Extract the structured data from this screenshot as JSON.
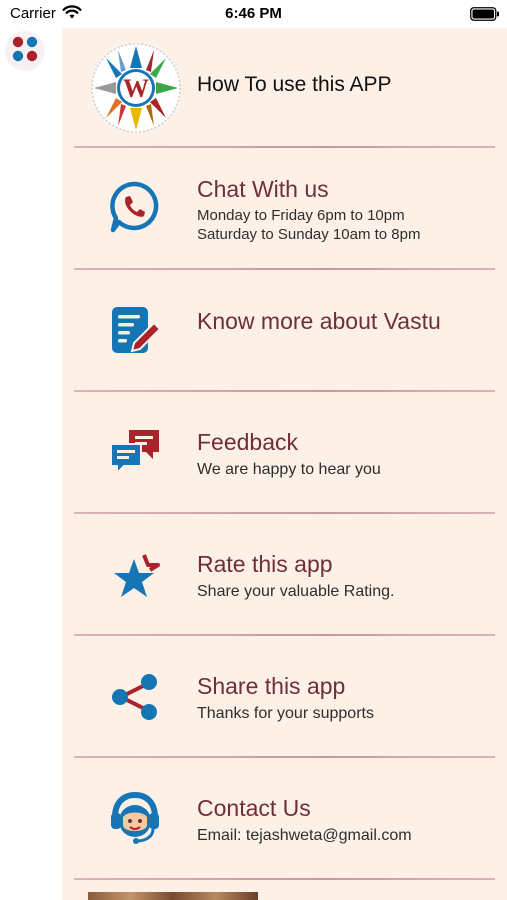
{
  "status_bar": {
    "carrier": "Carrier",
    "time": "6:46 PM"
  },
  "colors": {
    "accent_maroon": "#6e2f3c",
    "icon_blue": "#1675b4",
    "icon_red": "#a8232a",
    "drawer_bg": "#fdf0e6"
  },
  "menu": {
    "items": [
      {
        "icon": "app-logo-icon",
        "title": "How To use this APP"
      },
      {
        "icon": "whatsapp-icon",
        "title": "Chat With us",
        "subtitle_lines": [
          "Monday to Friday 6pm to 10pm",
          "Saturday to Sunday 10am to 8pm"
        ]
      },
      {
        "icon": "document-edit-icon",
        "title": "Know more about Vastu"
      },
      {
        "icon": "feedback-chat-icon",
        "title": "Feedback",
        "subtitle": "We are happy to hear you"
      },
      {
        "icon": "star-icon",
        "title": "Rate this app",
        "subtitle": "Share your valuable Rating."
      },
      {
        "icon": "share-icon",
        "title": "Share this app",
        "subtitle": "Thanks for your supports"
      },
      {
        "icon": "contact-support-icon",
        "title": "Contact Us",
        "subtitle": "Email: tejashweta@gmail.com"
      }
    ]
  }
}
